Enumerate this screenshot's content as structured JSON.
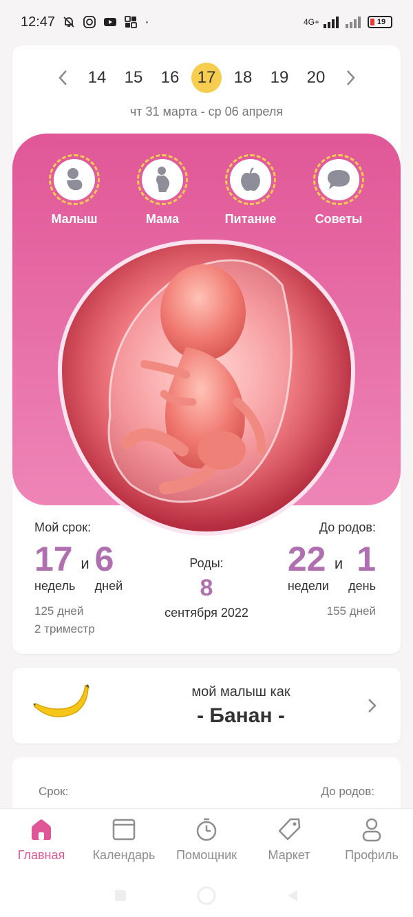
{
  "status_bar": {
    "time": "12:47",
    "network": "4G+",
    "battery": "19"
  },
  "week_nav": {
    "weeks": [
      "14",
      "15",
      "16",
      "17",
      "18",
      "19",
      "20"
    ],
    "active_index": 3,
    "date_range": "чт 31 марта - ср 06 апреля"
  },
  "categories": [
    {
      "label": "Малыш",
      "icon": "baby-icon"
    },
    {
      "label": "Мама",
      "icon": "pregnant-mother-icon"
    },
    {
      "label": "Питание",
      "icon": "apple-icon"
    },
    {
      "label": "Советы",
      "icon": "chat-bubble-icon"
    }
  ],
  "stats": {
    "my_term": {
      "label": "Мой срок:",
      "weeks": "17",
      "weeks_unit": "недель",
      "and": "и",
      "days": "6",
      "days_unit": "дней",
      "total_days": "125 дней",
      "trimester": "2 триместр"
    },
    "birth": {
      "label": "Роды:",
      "day": "8",
      "month_year": "сентября 2022"
    },
    "until_birth": {
      "label": "До родов:",
      "weeks": "22",
      "weeks_unit": "недели",
      "and": "и",
      "days": "1",
      "days_unit": "день",
      "total_days": "155 дней"
    }
  },
  "baby_size": {
    "caption": "мой малыш как",
    "fruit": "- Банан -"
  },
  "third_card": {
    "left_label": "Срок:",
    "right_label": "До родов:"
  },
  "bottom_nav": [
    {
      "label": "Главная",
      "icon": "home-icon",
      "active": true
    },
    {
      "label": "Календарь",
      "icon": "calendar-icon",
      "active": false
    },
    {
      "label": "Помощник",
      "icon": "timer-icon",
      "active": false
    },
    {
      "label": "Маркет",
      "icon": "tag-icon",
      "active": false
    },
    {
      "label": "Профиль",
      "icon": "profile-icon",
      "active": false
    }
  ],
  "colors": {
    "accent": "#e05797",
    "week_highlight": "#f6cd4f",
    "stat_purple": "#b06fae"
  }
}
